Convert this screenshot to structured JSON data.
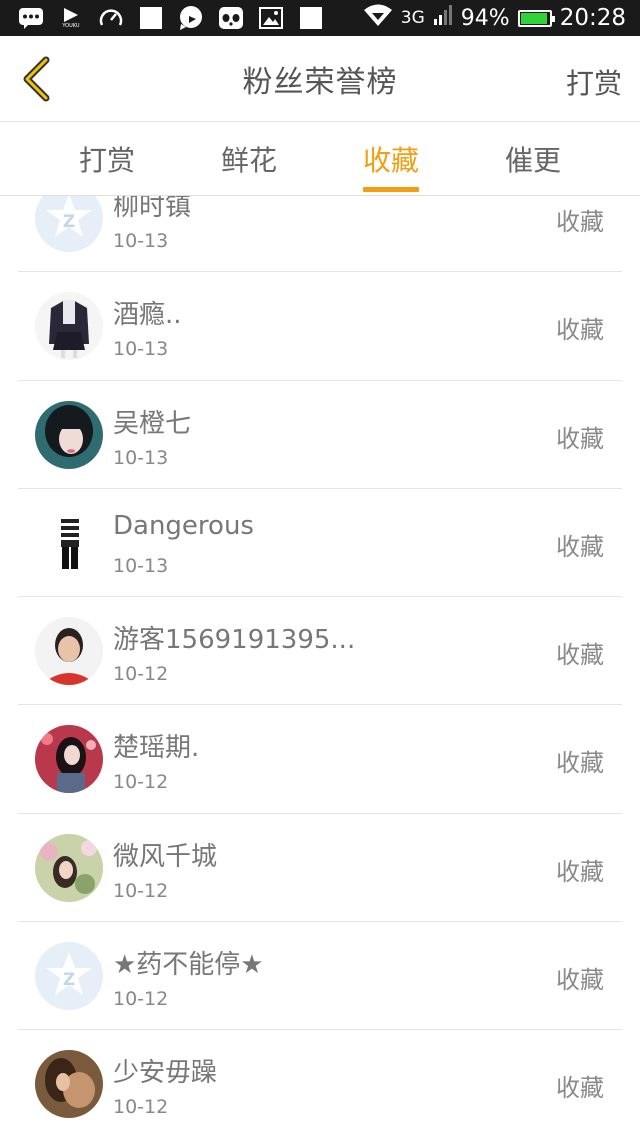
{
  "status_bar": {
    "network": "3G",
    "battery_percent": "94%",
    "time": "20:28",
    "left_icons": [
      "message-icon",
      "youku-icon",
      "speedometer-icon",
      "square-icon",
      "chat-bubble-icon",
      "panda-icon",
      "image-icon",
      "square-icon"
    ],
    "youku_label": "YOUKU"
  },
  "header": {
    "title": "粉丝荣誉榜",
    "action_label": "打赏",
    "back_icon": "chevron-left-icon",
    "accent_color": "#f0a012"
  },
  "tabs": [
    {
      "label": "打赏",
      "active": false
    },
    {
      "label": "鲜花",
      "active": false
    },
    {
      "label": "收藏",
      "active": true
    },
    {
      "label": "催更",
      "active": false
    }
  ],
  "list": {
    "items": [
      {
        "name": "柳时镇",
        "date": "10-13",
        "action": "收藏",
        "avatar": "default-avatar-icon"
      },
      {
        "name": "酒瘾..",
        "date": "10-13",
        "action": "收藏",
        "avatar": "user-photo"
      },
      {
        "name": "吴橙七",
        "date": "10-13",
        "action": "收藏",
        "avatar": "user-photo"
      },
      {
        "name": "Dangerous",
        "date": "10-13",
        "action": "收藏",
        "avatar": "user-photo"
      },
      {
        "name": "游客1569191395...",
        "date": "10-12",
        "action": "收藏",
        "avatar": "user-photo"
      },
      {
        "name": "楚瑶期.",
        "date": "10-12",
        "action": "收藏",
        "avatar": "user-photo"
      },
      {
        "name": "微风千城",
        "date": "10-12",
        "action": "收藏",
        "avatar": "user-photo"
      },
      {
        "name": "★药不能停★",
        "date": "10-12",
        "action": "收藏",
        "avatar": "default-avatar-icon"
      },
      {
        "name": "少安毋躁",
        "date": "10-12",
        "action": "收藏",
        "avatar": "user-photo"
      }
    ]
  }
}
